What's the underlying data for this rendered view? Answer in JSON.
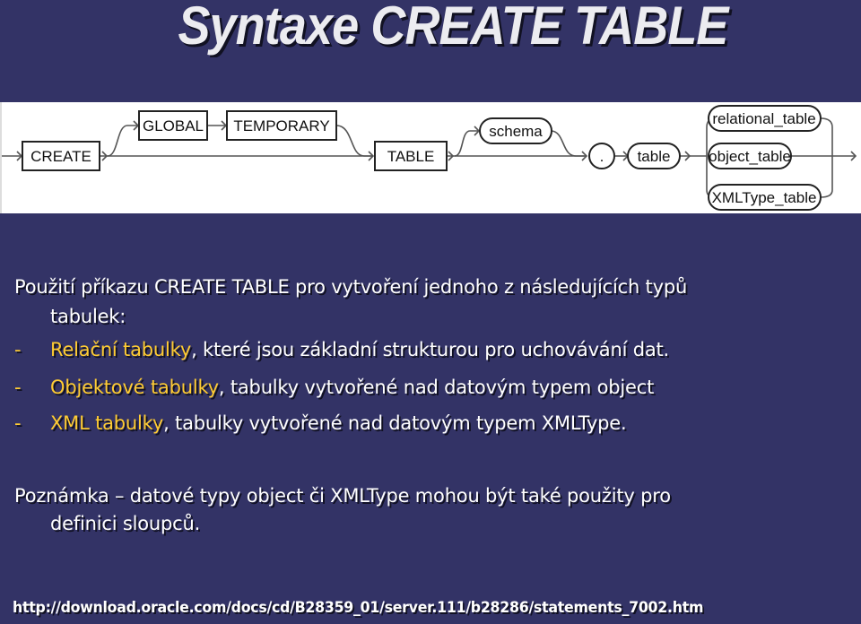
{
  "slide": {
    "title": "Syntaxe CREATE TABLE",
    "background_color": "#333366",
    "highlight_color": "#ffcc33"
  },
  "diagram": {
    "keywords": {
      "create": "CREATE",
      "global": "GLOBAL",
      "temporary": "TEMPORARY",
      "table_kw": "TABLE"
    },
    "terms": {
      "schema": "schema",
      "dot": ".",
      "table": "table",
      "relational_table": "relational_table",
      "object_table": "object_table",
      "xmltype_table": "XMLType_table"
    }
  },
  "content": {
    "intro_line1": "Použití příkazu CREATE TABLE pro vytvoření jednoho z následujících typů",
    "intro_line2": "tabulek:",
    "bullets": [
      {
        "dash": "-",
        "highlight": "Relační tabulky",
        "rest": ", které jsou základní strukturou pro uchovávání dat."
      },
      {
        "dash": "-",
        "highlight": "Objektové tabulky",
        "rest": ", tabulky vytvořené nad datovým typem object"
      },
      {
        "dash": "-",
        "highlight": "XML tabulky",
        "rest": ", tabulky vytvořené nad datovým typem XMLType."
      }
    ],
    "note_line1": "Poznámka – datové typy object či XMLType mohou být také použity pro",
    "note_line2": "definici sloupců."
  },
  "footer": {
    "url": "http://download.oracle.com/docs/cd/B28359_01/server.111/b28286/statements_7002.htm"
  }
}
